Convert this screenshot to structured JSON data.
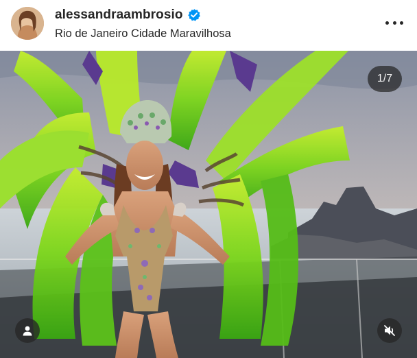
{
  "post": {
    "username": "alessandraambrosio",
    "location": "Rio de Janeiro Cidade Maravilhosa",
    "carousel_counter": "1/7",
    "verified": true
  },
  "icons": {
    "avatar": "profile-photo",
    "verified": "verified-badge-icon",
    "more": "more-options-icon",
    "tags": "user-tag-icon",
    "audio": "muted-speaker-icon"
  },
  "colors": {
    "verified_blue": "#0095f6",
    "text": "#262626",
    "overlay": "#262626"
  }
}
